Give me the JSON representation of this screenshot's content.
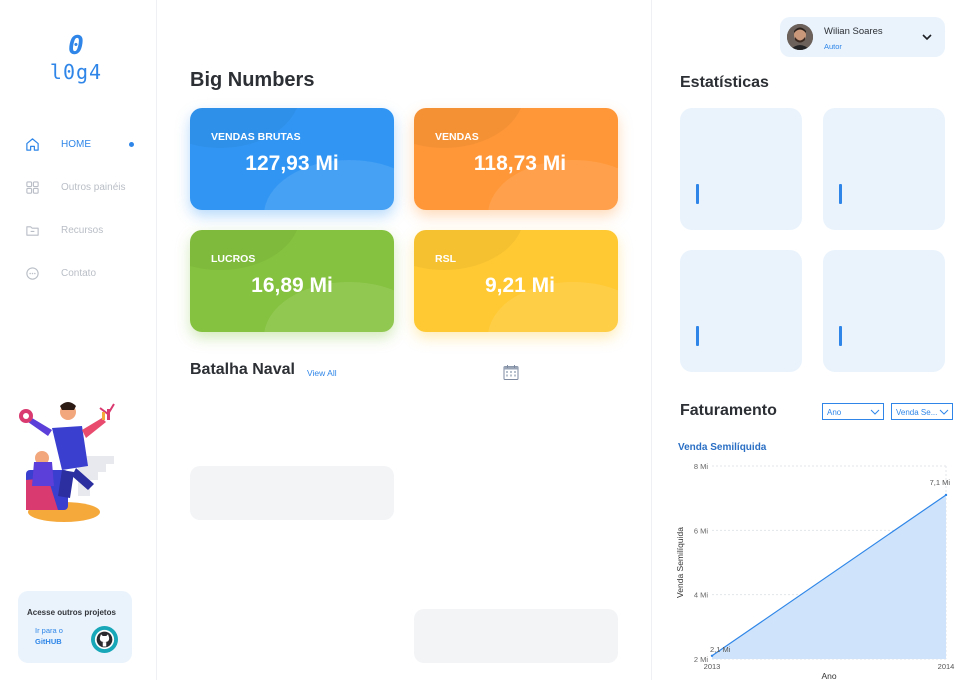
{
  "sidebar": {
    "logo": {
      "line1": "0",
      "line2": "l0g4"
    },
    "nav": [
      {
        "label": "HOME",
        "icon": "home-icon",
        "active": true
      },
      {
        "label": "Outros painéis",
        "icon": "grid-icon",
        "active": false
      },
      {
        "label": "Recursos",
        "icon": "folder-icon",
        "active": false
      },
      {
        "label": "Contato",
        "icon": "chat-icon",
        "active": false
      }
    ],
    "github_card": {
      "title": "Acesse outros projetos",
      "line1": "Ir para o",
      "line2": "GitHUB",
      "icon": "github-icon"
    }
  },
  "main": {
    "big_numbers_title": "Big Numbers",
    "cards": [
      {
        "title": "VENDAS BRUTAS",
        "value": "127,93 Mi",
        "color": "#3196f3"
      },
      {
        "title": "VENDAS",
        "value": "118,73 Mi",
        "color": "#ff9738"
      },
      {
        "title": "LUCROS",
        "value": "16,89 Mi",
        "color": "#85c23f"
      },
      {
        "title": "RSL",
        "value": "9,21 Mi",
        "color": "#ffc933"
      }
    ],
    "batalha_title": "Batalha Naval",
    "view_all": "View All",
    "calendar_icon": "calendar-icon"
  },
  "right": {
    "user": {
      "name": "Wilian Soares",
      "role": "Autor"
    },
    "estatisticas_title": "Estatísticas",
    "faturamento_title": "Faturamento",
    "filters": [
      {
        "value": "Ano"
      },
      {
        "value": "Venda Se..."
      }
    ]
  },
  "chart_data": {
    "type": "area",
    "title": "Venda Semilíquida",
    "xlabel": "Ano",
    "ylabel": "Venda Semilíquida",
    "x": [
      "2013",
      "2014"
    ],
    "series": [
      {
        "values": [
          2.1,
          7.1
        ]
      }
    ],
    "data_labels": [
      "2,1 Mi",
      "7,1 Mi"
    ],
    "yticks": [
      "2 Mi",
      "4 Mi",
      "6 Mi",
      "8 Mi"
    ],
    "ylim": [
      2,
      8
    ],
    "grid": true,
    "color": "#2f86e8"
  }
}
